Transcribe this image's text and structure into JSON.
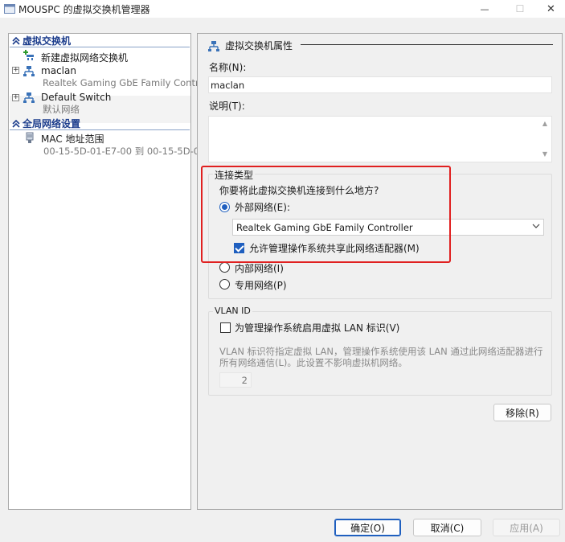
{
  "window": {
    "title": "MOUSPC 的虚拟交换机管理器",
    "minimize_glyph": "—",
    "maximize_glyph": "☐",
    "close_glyph": "✕"
  },
  "tree": {
    "virtual_switches_header": "虚拟交换机",
    "new_switch": "新建虚拟网络交换机",
    "switches": [
      {
        "name": "maclan",
        "subtitle": "Realtek Gaming GbE Family Controller",
        "expander": "+"
      },
      {
        "name": "Default Switch",
        "subtitle": "默认网络",
        "expander": "+"
      }
    ],
    "global_header": "全局网络设置",
    "mac_range": {
      "name": "MAC 地址范围",
      "subtitle": "00-15-5D-01-E7-00 到 00-15-5D-0..."
    }
  },
  "props": {
    "header": "虚拟交换机属性",
    "name_label": "名称(N):",
    "name_value": "maclan",
    "notes_label": "说明(T):",
    "connection_type": {
      "title": "连接类型",
      "question": "你要将此虚拟交换机连接到什么地方?",
      "external_label": "外部网络(E):",
      "adapter_selected": "Realtek Gaming GbE Family Controller",
      "allow_share_label": "允许管理操作系统共享此网络适配器(M)",
      "internal_label": "内部网络(I)",
      "private_label": "专用网络(P)",
      "selected": "external",
      "allow_share_checked": true
    },
    "vlan": {
      "title": "VLAN ID",
      "enable_label": "为管理操作系统启用虚拟 LAN 标识(V)",
      "enabled": false,
      "description_line1": "VLAN 标识符指定虚拟 LAN，管理操作系统使用该 LAN 通过此网络适配器进行",
      "description_line2": "所有网络通信(L)。此设置不影响虚拟机网络。",
      "value": "2"
    },
    "remove_button": "移除(R)"
  },
  "footer": {
    "ok": "确定(O)",
    "cancel": "取消(C)",
    "apply": "应用(A)"
  },
  "colors": {
    "accent": "#1f5fbf",
    "header_text": "#1c3d8c",
    "highlight_box": "#e02020"
  }
}
